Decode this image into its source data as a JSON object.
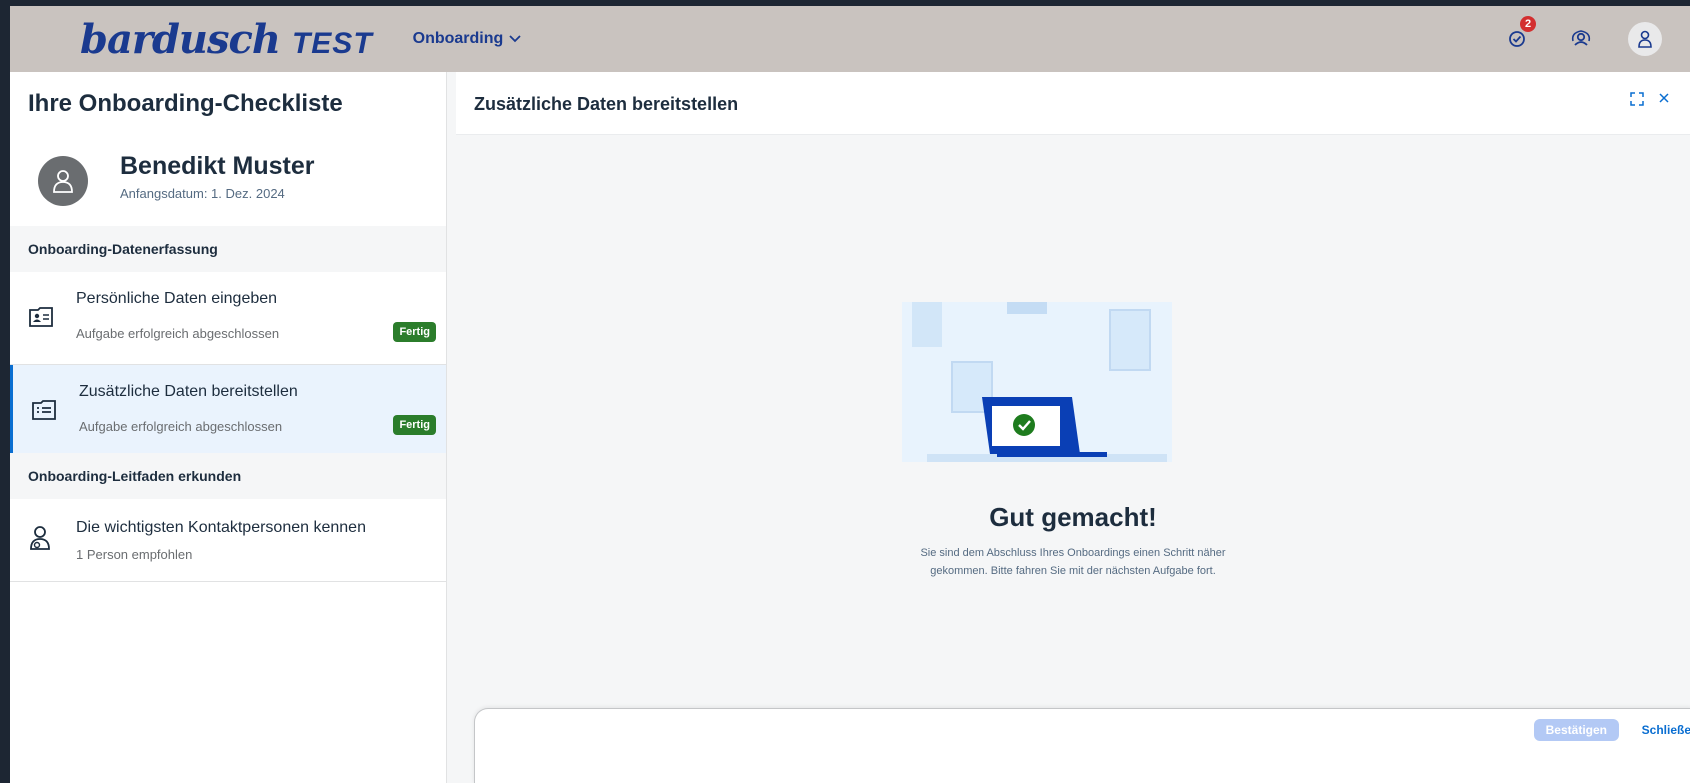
{
  "shell": {
    "logo_word": "bardusch",
    "logo_env": "TEST",
    "menu_label": "Onboarding",
    "notifications_count": "2"
  },
  "left": {
    "title": "Ihre Onboarding-Checkliste",
    "profile": {
      "name": "Benedikt Muster",
      "start_date": "Anfangsdatum: 1. Dez. 2024"
    },
    "sections": [
      {
        "label": "Onboarding-Datenerfassung"
      },
      {
        "label": "Onboarding-Leitfaden erkunden"
      }
    ],
    "items": [
      {
        "title": "Persönliche Daten eingeben",
        "subtitle": "Aufgabe erfolgreich abgeschlossen",
        "status": "Fertig"
      },
      {
        "title": "Zusätzliche Daten bereitstellen",
        "subtitle": "Aufgabe erfolgreich abgeschlossen",
        "status": "Fertig"
      },
      {
        "title": "Die wichtigsten Kontaktpersonen kennen",
        "subtitle": "1 Person empfohlen"
      }
    ]
  },
  "right": {
    "title": "Zusätzliche Daten bereitstellen",
    "success_heading": "Gut gemacht!",
    "success_line1": "Sie sind dem Abschluss Ihres Onboardings einen Schritt näher",
    "success_line2": "gekommen. Bitte fahren Sie mit der nächsten Aufgabe fort.",
    "confirm_label": "Bestätigen",
    "close_label": "Schließe"
  }
}
